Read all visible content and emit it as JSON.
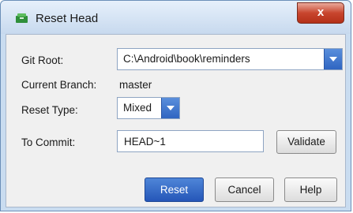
{
  "window": {
    "title": "Reset Head",
    "close_label": "x"
  },
  "form": {
    "git_root_label": "Git Root:",
    "git_root_value": "C:\\Android\\book\\reminders",
    "current_branch_label": "Current Branch:",
    "current_branch_value": "master",
    "reset_type_label": "Reset Type:",
    "reset_type_value": "Mixed",
    "to_commit_label": "To Commit:",
    "to_commit_value": "HEAD~1",
    "validate_label": "Validate"
  },
  "buttons": {
    "reset": "Reset",
    "cancel": "Cancel",
    "help": "Help"
  },
  "icons": {
    "title_icon": "git-reset-icon",
    "dropdown_arrow": "chevron-down-icon"
  }
}
